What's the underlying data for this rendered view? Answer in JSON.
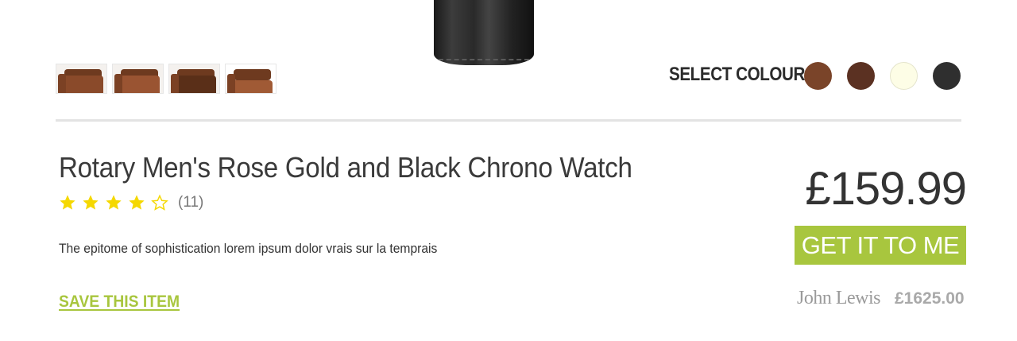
{
  "gallery": {
    "thumbnails": [
      "sofa-thumbnail-1",
      "sofa-thumbnail-2",
      "sofa-thumbnail-3",
      "sofa-thumbnail-4"
    ]
  },
  "colour_selector": {
    "label": "SELECT COLOUR",
    "swatches": [
      {
        "name": "tan-brown",
        "color": "#7a4429"
      },
      {
        "name": "dark-brown",
        "color": "#5b3122"
      },
      {
        "name": "cream",
        "color": "#fdfde6"
      },
      {
        "name": "charcoal",
        "color": "#2f2f2f"
      }
    ]
  },
  "product": {
    "title": "Rotary Men's Rose Gold and Black Chrono Watch",
    "rating": {
      "value": 4,
      "max": 5,
      "count_text": "(11)"
    },
    "description": "The epitome of sophistication lorem ipsum dolor vrais sur la temprais",
    "save_label": "SAVE THIS ITEM",
    "price": "£159.99",
    "cta_label": "GET IT TO ME",
    "retailer": {
      "name": "John Lewis",
      "price": "£1625.00"
    }
  },
  "colors": {
    "accent": "#a8c63e",
    "star": "#f5d800",
    "text": "#333333"
  }
}
